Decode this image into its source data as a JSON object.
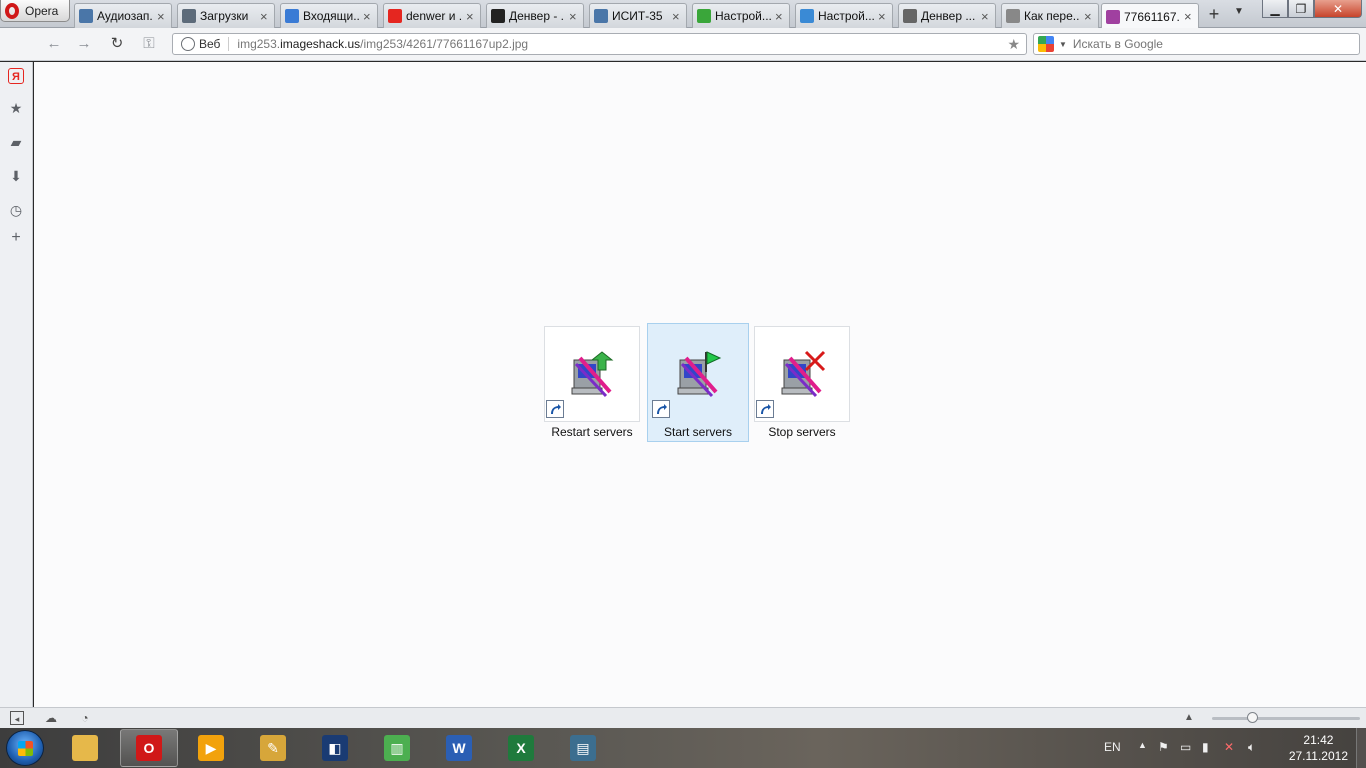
{
  "browser": {
    "menu_label": "Opera",
    "tabs": [
      {
        "title": "Аудиозап...",
        "favicon": "vk-audio-icon",
        "color": "#4a76a8"
      },
      {
        "title": "Загрузки",
        "favicon": "downloads-icon",
        "color": "#5d6b7a"
      },
      {
        "title": "Входящи...",
        "favicon": "mail-icon",
        "color": "#3a7bd5"
      },
      {
        "title": "denwer и ...",
        "favicon": "yandex-icon",
        "color": "#e52620"
      },
      {
        "title": "Денвер - ...",
        "favicon": "denwer-hat-icon",
        "color": "#222222"
      },
      {
        "title": "ИСИТ-35",
        "favicon": "vk-icon",
        "color": "#4a76a8"
      },
      {
        "title": "Настрой...",
        "favicon": "info-icon",
        "color": "#3aa63a"
      },
      {
        "title": "Настрой...",
        "favicon": "check-icon",
        "color": "#3a8ad5"
      },
      {
        "title": "Денвер ...",
        "favicon": "runner-icon",
        "color": "#666666"
      },
      {
        "title": "Как пере...",
        "favicon": "page-icon",
        "color": "#888888"
      },
      {
        "title": "77661167...",
        "favicon": "image-icon",
        "color": "#a040a0"
      }
    ],
    "active_tab_index": 10,
    "address": {
      "web_label": "Веб",
      "url_prefix": "img253.",
      "url_host": "imageshack.us",
      "url_path": "/img253/4261/77661167up2.jpg"
    },
    "search": {
      "placeholder": "Искать в Google"
    }
  },
  "content": {
    "shortcuts": [
      {
        "label": "Restart servers",
        "badge": "green-arrow",
        "selected": false
      },
      {
        "label": "Start servers",
        "badge": "green-flag",
        "selected": true
      },
      {
        "label": "Stop servers",
        "badge": "red-x",
        "selected": false
      }
    ]
  },
  "taskbar": {
    "apps": [
      {
        "name": "explorer",
        "color": "#e6b84a",
        "glyph": ""
      },
      {
        "name": "opera",
        "color": "#d01818",
        "glyph": "O",
        "running": true
      },
      {
        "name": "media",
        "color": "#f2a20c",
        "glyph": "▶"
      },
      {
        "name": "paint",
        "color": "#d7a63a",
        "glyph": "✎"
      },
      {
        "name": "dolby",
        "color": "#1a3b73",
        "glyph": "◧"
      },
      {
        "name": "network",
        "color": "#4caf50",
        "glyph": "▥"
      },
      {
        "name": "word",
        "color": "#2b5fb4",
        "glyph": "W"
      },
      {
        "name": "excel",
        "color": "#1f7a3c",
        "glyph": "X"
      },
      {
        "name": "reader",
        "color": "#3c6e8f",
        "glyph": "▤"
      }
    ],
    "language": "EN",
    "time": "21:42",
    "date": "27.11.2012"
  }
}
